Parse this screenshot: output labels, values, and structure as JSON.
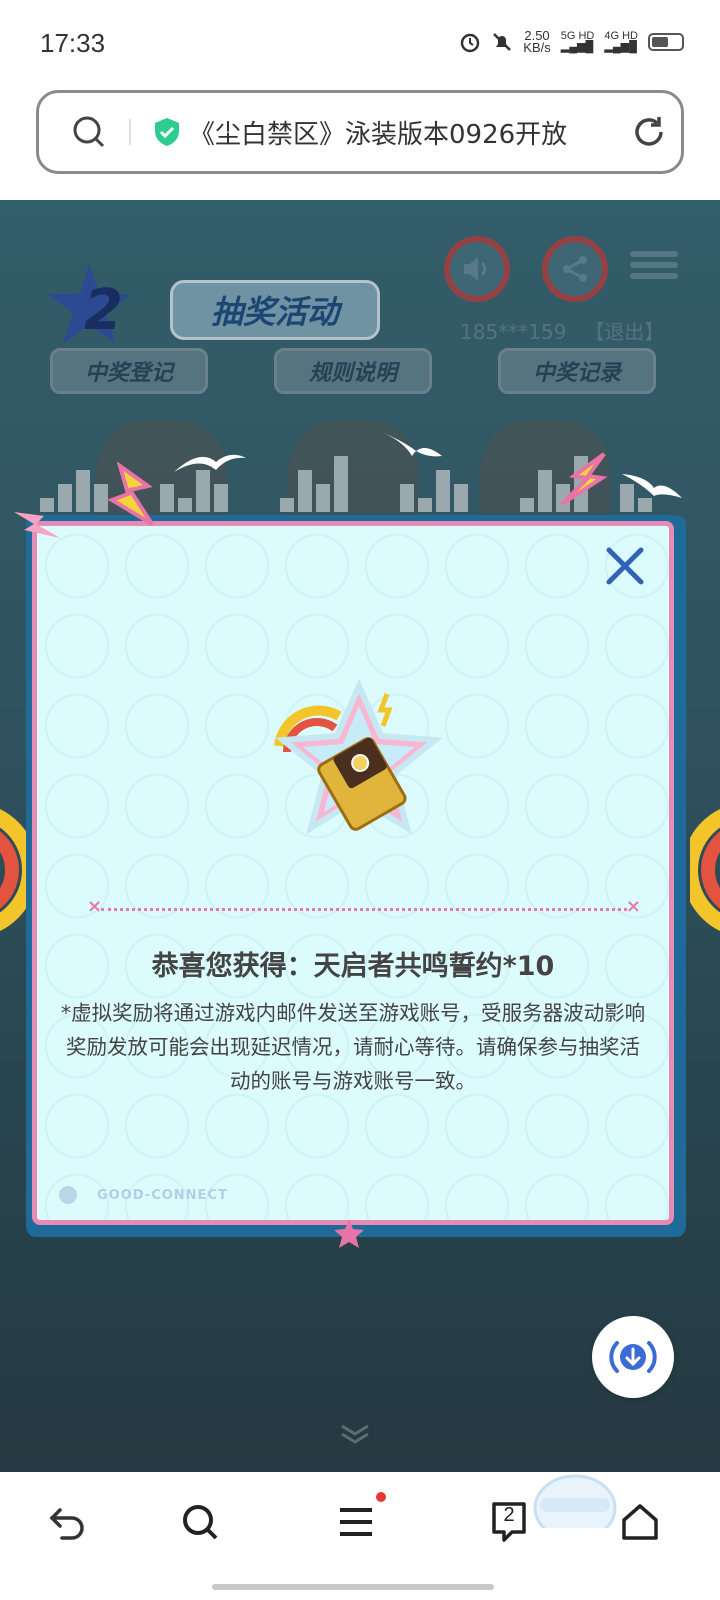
{
  "status_bar": {
    "time": "17:33",
    "speed_value": "2.50",
    "speed_unit": "KB/s",
    "network_1": "5G HD",
    "network_2": "4G HD"
  },
  "url_bar": {
    "url_text": "《尘白禁区》泳装版本0926开放"
  },
  "page": {
    "banner_number": "2",
    "banner_title": "抽奖活动",
    "user_phone": "185***159",
    "logout_label": "【退出】",
    "tabs": [
      "中奖登记",
      "规则说明",
      "中奖记录"
    ]
  },
  "modal": {
    "congrats_text": "恭喜您获得：天启者共鸣誓约*10",
    "notice_text": "*虚拟奖励将通过游戏内邮件发送至游戏账号，受服务器波动影响奖励发放可能会出现延迟情况，请耐心等待。请确保参与抽奖活动的账号与游戏账号一致。",
    "footer_mark": "GOOD-CONNECT"
  },
  "bottom_nav": {
    "tab_count": "2"
  },
  "colors": {
    "modal_border": "#e58bb4",
    "modal_bg": "#dcfbfd",
    "modal_frame": "#1e6a98",
    "accent_blue": "#3d6bd6",
    "safe_green": "#2ecc8f"
  }
}
